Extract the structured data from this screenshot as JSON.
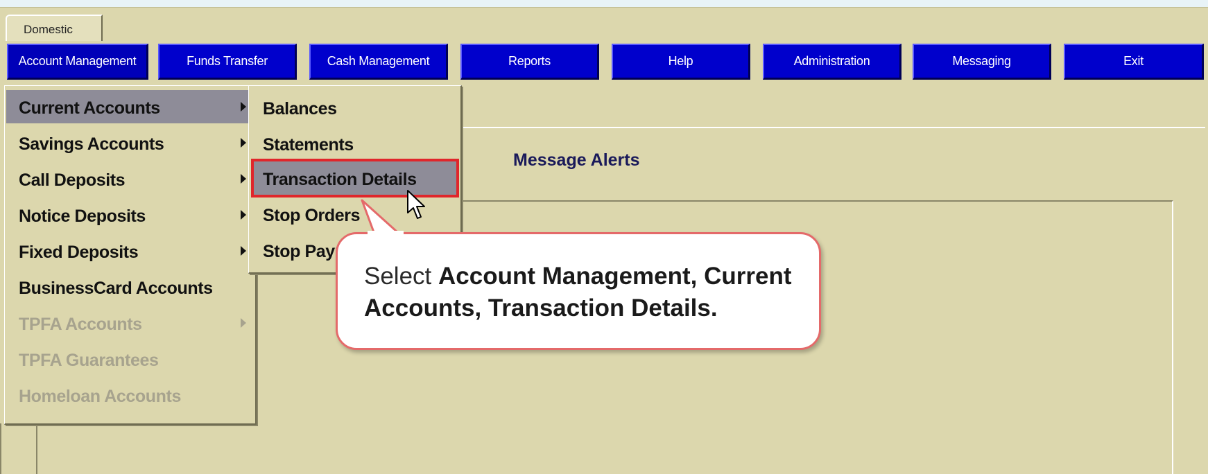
{
  "tab": {
    "label": "Domestic"
  },
  "toolbar": {
    "buttons": [
      {
        "label": "Account Management"
      },
      {
        "label": "Funds Transfer"
      },
      {
        "label": "Cash Management"
      },
      {
        "label": "Reports"
      },
      {
        "label": "Help"
      },
      {
        "label": "Administration"
      },
      {
        "label": "Messaging"
      },
      {
        "label": "Exit"
      }
    ]
  },
  "menu": {
    "items": [
      {
        "label": "Current Accounts",
        "submenu": true,
        "enabled": true,
        "selected": true
      },
      {
        "label": "Savings Accounts",
        "submenu": true,
        "enabled": true
      },
      {
        "label": "Call Deposits",
        "submenu": true,
        "enabled": true
      },
      {
        "label": "Notice Deposits",
        "submenu": true,
        "enabled": true
      },
      {
        "label": "Fixed Deposits",
        "submenu": true,
        "enabled": true
      },
      {
        "label": "BusinessCard Accounts",
        "submenu": false,
        "enabled": true
      },
      {
        "label": "TPFA Accounts",
        "submenu": true,
        "enabled": false
      },
      {
        "label": "TPFA Guarantees",
        "submenu": false,
        "enabled": false
      },
      {
        "label": "Homeloan Accounts",
        "submenu": false,
        "enabled": false
      }
    ]
  },
  "submenu": {
    "items": [
      {
        "label": "Balances"
      },
      {
        "label": "Statements"
      },
      {
        "label": "Transaction Details",
        "highlighted": true
      },
      {
        "label": "Stop Orders"
      },
      {
        "label": "Stop Payments"
      }
    ]
  },
  "main": {
    "alerts_title": "Message Alerts"
  },
  "callout": {
    "prefix": "Select ",
    "bold_1": "Account Management, Current",
    "bold_2": "Accounts, Transaction Details."
  },
  "colors": {
    "app_bg": "#dcd7ad",
    "toolbar_button": "#0000cc",
    "menu_selected": "#8e8c98",
    "highlight_border": "#e0262b",
    "callout_border": "#e46a6a"
  },
  "icons": {
    "cursor": "arrow-pointer-icon",
    "submenu_arrow": "triangle-right-icon"
  }
}
